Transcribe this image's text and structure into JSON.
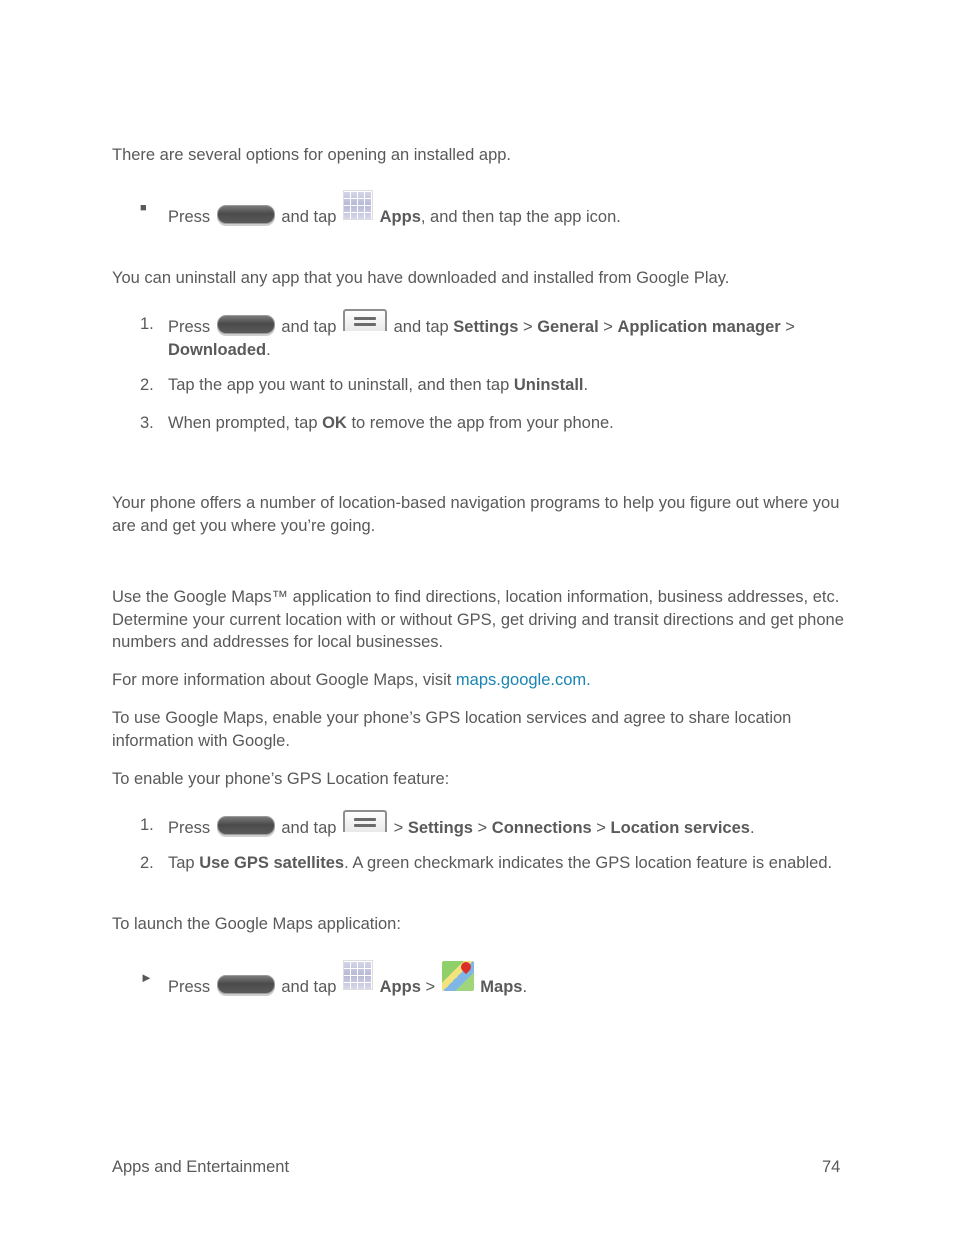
{
  "intro": "There are several options for opening an installed app.",
  "open_app": {
    "marker": "■",
    "press": "Press",
    "and_tap": "and tap",
    "apps": "Apps",
    "rest": ", and then tap the app icon."
  },
  "uninstall_intro": "You can uninstall any app that you have downloaded and installed from Google Play.",
  "uninstall_steps": {
    "s1": {
      "num": "1.",
      "press": "Press",
      "and_tap": "and tap",
      "and_tap2": "and tap",
      "settings": "Settings",
      "sep": ">",
      "general": "General",
      "app_manager": "Application manager",
      "downloaded": "Downloaded",
      "end": "."
    },
    "s2": {
      "num": "2.",
      "pre": "Tap the app you want to uninstall, and then tap",
      "bold": "Uninstall",
      "end": "."
    },
    "s3": {
      "num": "3.",
      "pre": "When prompted, tap",
      "bold": "OK",
      "end": "to remove the app from your phone."
    }
  },
  "nav_intro": "Your phone offers a number of location-based navigation programs to help you figure out where you are and get you where you’re going.",
  "maps_intro": "Use the Google Maps™ application to find directions, location information, business addresses, etc. Determine your current location with or without GPS, get driving and transit directions and get phone numbers and addresses for local businesses.",
  "more_info": {
    "text": "For more information about Google Maps, visit",
    "link": "maps.google.com",
    "end": "."
  },
  "use_maps": "To use Google Maps, enable your phone’s GPS location services and agree to share location information with Google.",
  "enable_gps": "To enable your phone’s GPS Location feature:",
  "gps_steps": {
    "s1": {
      "num": "1.",
      "press": "Press",
      "and_tap": "and tap",
      "sep": ">",
      "settings": "Settings",
      "connections": "Connections",
      "location": "Location services",
      "end": "."
    },
    "s2": {
      "num": "2.",
      "pre": "Tap",
      "bold": "Use GPS satellites",
      "rest": ". A green checkmark indicates the GPS location feature is enabled."
    }
  },
  "launch_maps": "To launch the Google Maps application:",
  "launch_step": {
    "marker": "►",
    "press": "Press",
    "and_tap": "and tap",
    "apps": "Apps",
    "sep": ">",
    "maps": "Maps",
    "end": "."
  },
  "footer": {
    "section": "Apps and Entertainment",
    "page": "74"
  }
}
